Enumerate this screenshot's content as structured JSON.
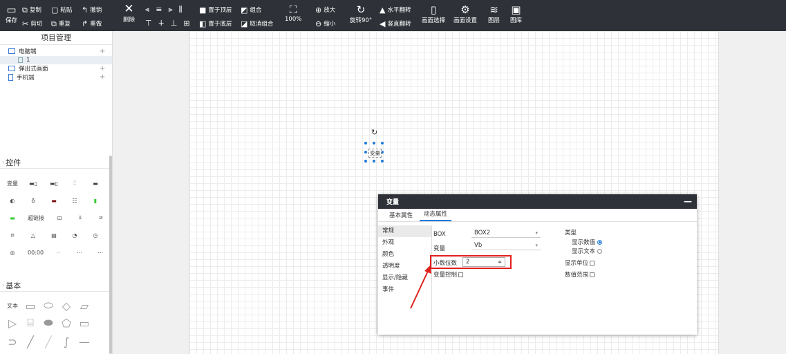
{
  "toolbar": {
    "save": "保存",
    "copy": "复制",
    "cut": "剪切",
    "paste": "粘贴",
    "repeat": "重复",
    "undo": "撤销",
    "redo": "重做",
    "delete": "删除",
    "bring_top": "置于顶层",
    "send_bottom": "置于底层",
    "group": "组合",
    "ungroup": "取消组合",
    "zoom": "100%",
    "zoom_in": "放大",
    "zoom_out": "缩小",
    "rotate": "旋转90°",
    "flip_h": "水平翻转",
    "flip_v": "竖直翻转",
    "screen_select": "画面选择",
    "screen_settings": "画面设置",
    "layers": "图层",
    "gallery": "图库"
  },
  "sidebar": {
    "title": "项目管理",
    "tree": [
      {
        "label": "电脑端",
        "icon": "monitor-icon",
        "plus": "+"
      },
      {
        "label": "1",
        "icon": "page-icon",
        "plus": ""
      },
      {
        "label": "弹出式画面",
        "icon": "popup-icon",
        "plus": "+"
      },
      {
        "label": "手机端",
        "icon": "phone-icon",
        "plus": "+"
      }
    ],
    "controls_title": "控件",
    "controls_row1": [
      "变量"
    ],
    "controls_row3_link": "超链接",
    "controls_row5": [
      "00:00"
    ],
    "basic_title": "基本",
    "basic_text": "文本"
  },
  "canvas": {
    "element_label": "变量"
  },
  "dialog": {
    "title": "变量",
    "minimize": "—",
    "tabs": [
      "基本属性",
      "动态属性"
    ],
    "left_items": [
      "常规",
      "外观",
      "颜色",
      "透明度",
      "显示/隐藏",
      "事件"
    ],
    "box_label": "BOX",
    "box_value": "BOX2",
    "var_label": "变量",
    "var_value": "Vb",
    "decimals_label": "小数位数",
    "decimals_value": "2",
    "var_control_label": "变量控制",
    "type_label": "类型",
    "show_value": "显示数值",
    "show_text": "显示文本",
    "show_unit": "显示单位",
    "value_range": "数值范围"
  },
  "colors": {
    "toolbar_bg": "#2e3238",
    "accent": "#1e7bd8",
    "highlight": "#e0201c"
  }
}
